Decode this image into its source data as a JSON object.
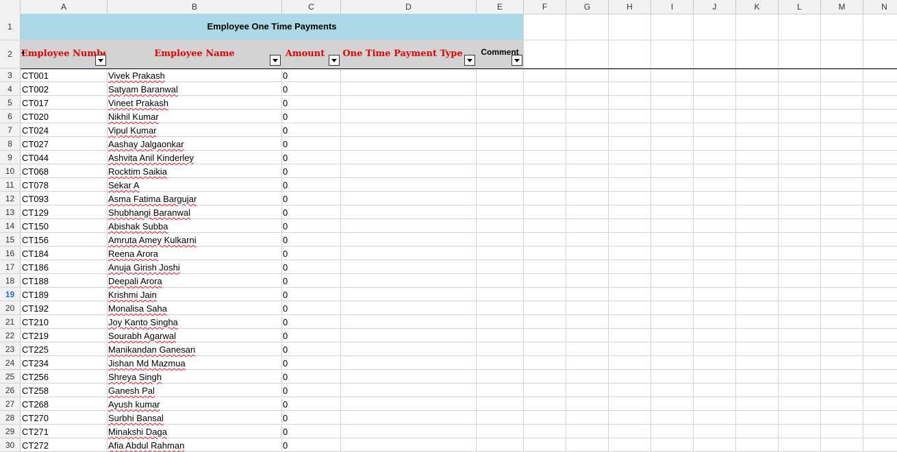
{
  "columns": [
    "A",
    "B",
    "C",
    "D",
    "E",
    "F",
    "G",
    "H",
    "I",
    "J",
    "K",
    "L",
    "M",
    "N"
  ],
  "active_row": "19",
  "title": "Employee One Time Payments",
  "headers": {
    "employee_number": "Employee Number",
    "employee_name": "Employee Name",
    "amount": "Amount",
    "payment_type": "One Time Payment Type",
    "comment": "Comment"
  },
  "colors": {
    "title_bg": "#add8e6",
    "header_bg": "#d3d3d3",
    "header_text": "#e00000",
    "active_row_header": "#1a6fd6"
  },
  "rows": [
    {
      "row": "3",
      "id": "CT001",
      "name": "Vivek Prakash",
      "amount": "0"
    },
    {
      "row": "4",
      "id": "CT002",
      "name": "Satyam Baranwal",
      "amount": "0"
    },
    {
      "row": "5",
      "id": "CT017",
      "name": "Vineet Prakash",
      "amount": "0"
    },
    {
      "row": "6",
      "id": "CT020",
      "name": "Nikhil Kumar",
      "amount": "0"
    },
    {
      "row": "7",
      "id": "CT024",
      "name": "Vipul Kumar",
      "amount": "0"
    },
    {
      "row": "8",
      "id": "CT027",
      "name": "Aashay Jalgaonkar",
      "amount": "0"
    },
    {
      "row": "9",
      "id": "CT044",
      "name": "Ashvita Anil Kinderley",
      "amount": "0"
    },
    {
      "row": "10",
      "id": "CT068",
      "name": "Rocktim Saikia",
      "amount": "0"
    },
    {
      "row": "11",
      "id": "CT078",
      "name": "Sekar A",
      "amount": "0"
    },
    {
      "row": "12",
      "id": "CT093",
      "name": "Asma Fatima Bargujar",
      "amount": "0"
    },
    {
      "row": "13",
      "id": "CT129",
      "name": "Shubhangi Baranwal",
      "amount": "0"
    },
    {
      "row": "14",
      "id": "CT150",
      "name": "Abishak Subba",
      "amount": "0"
    },
    {
      "row": "15",
      "id": "CT156",
      "name": "Amruta Amey Kulkarni",
      "amount": "0"
    },
    {
      "row": "16",
      "id": "CT184",
      "name": "Reena Arora",
      "amount": "0"
    },
    {
      "row": "17",
      "id": "CT186",
      "name": "Anuja Girish Joshi",
      "amount": "0"
    },
    {
      "row": "18",
      "id": "CT188",
      "name": "Deepali Arora",
      "amount": "0"
    },
    {
      "row": "19",
      "id": "CT189",
      "name": "Krishmi Jain",
      "amount": "0"
    },
    {
      "row": "20",
      "id": "CT192",
      "name": "Monalisa Saha",
      "amount": "0"
    },
    {
      "row": "21",
      "id": "CT210",
      "name": "Joy Kanto Singha",
      "amount": "0"
    },
    {
      "row": "22",
      "id": "CT219",
      "name": "Sourabh Agarwal",
      "amount": "0"
    },
    {
      "row": "23",
      "id": "CT225",
      "name": "Manikandan Ganesan",
      "amount": "0"
    },
    {
      "row": "24",
      "id": "CT234",
      "name": "Jishan Md Mazmua",
      "amount": "0"
    },
    {
      "row": "25",
      "id": "CT256",
      "name": "Shreya Singh",
      "amount": "0"
    },
    {
      "row": "26",
      "id": "CT258",
      "name": "Ganesh Pal",
      "amount": "0"
    },
    {
      "row": "27",
      "id": "CT268",
      "name": "Ayush kumar",
      "amount": "0"
    },
    {
      "row": "28",
      "id": "CT270",
      "name": "Surbhi Bansal",
      "amount": "0"
    },
    {
      "row": "29",
      "id": "CT271",
      "name": "Minakshi Daga",
      "amount": "0"
    },
    {
      "row": "30",
      "id": "CT272",
      "name": "Afia Abdul Rahman",
      "amount": "0"
    }
  ]
}
